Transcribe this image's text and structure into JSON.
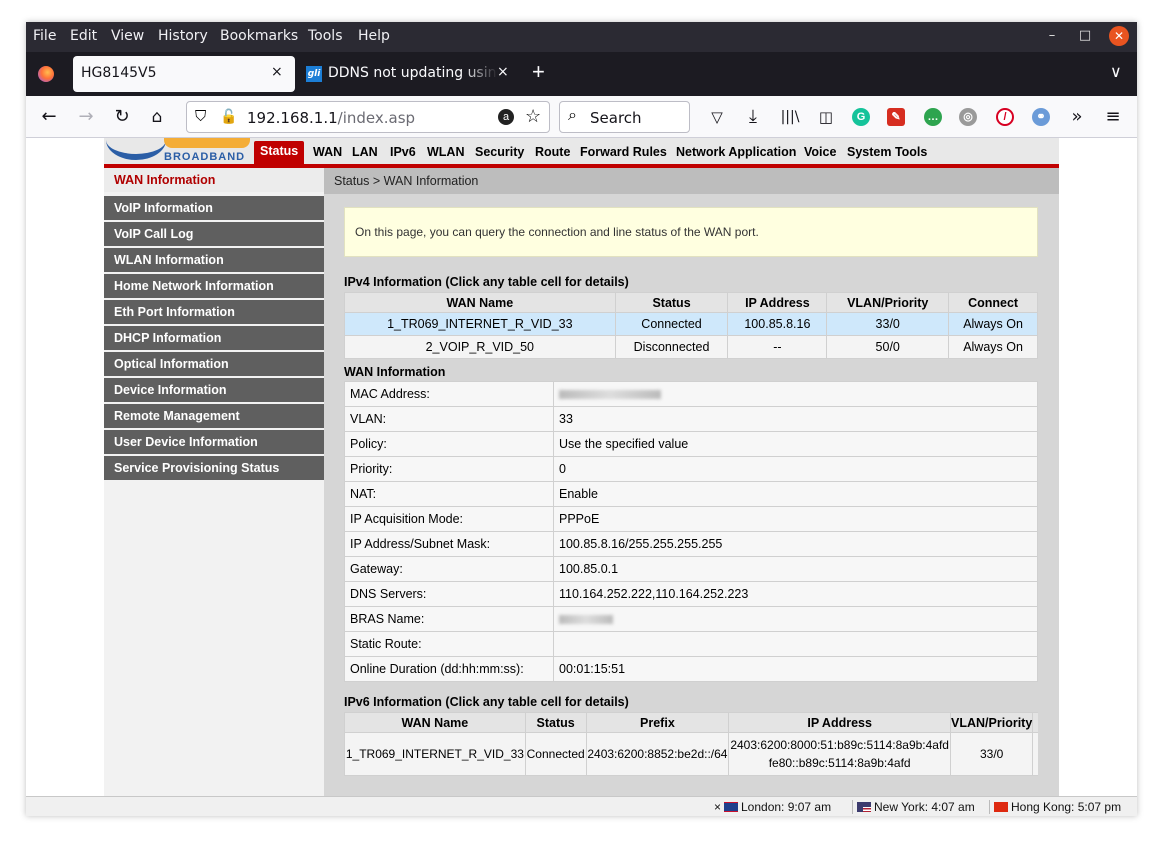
{
  "browser": {
    "menus": [
      "File",
      "Edit",
      "View",
      "History",
      "Bookmarks",
      "Tools",
      "Help"
    ],
    "tabs": [
      {
        "title": "HG8145V5",
        "close": "×"
      },
      {
        "title": "DDNS not updating using",
        "close": "×",
        "icon_text": "gli"
      }
    ],
    "new_tab": "+",
    "url_host": "192.168.1.1",
    "url_path": "/index.asp",
    "search_placeholder": "Search"
  },
  "router": {
    "logo_text": "BROADBAND",
    "top_nav": [
      "Status",
      "WAN",
      "LAN",
      "IPv6",
      "WLAN",
      "Security",
      "Route",
      "Forward Rules",
      "Network Application",
      "Voice",
      "System Tools"
    ],
    "sidebar": [
      "WAN Information",
      "VoIP Information",
      "VoIP Call Log",
      "WLAN Information",
      "Home Network Information",
      "Eth Port Information",
      "DHCP Information",
      "Optical Information",
      "Device Information",
      "Remote Management",
      "User Device Information",
      "Service Provisioning Status"
    ],
    "breadcrumb": "Status > WAN Information",
    "notice": "On this page, you can query the connection and line status of the WAN port.",
    "ipv4_title": "IPv4 Information (Click any table cell for details)",
    "ipv4_headers": [
      "WAN Name",
      "Status",
      "IP Address",
      "VLAN/Priority",
      "Connect"
    ],
    "ipv4_rows": [
      [
        "1_TR069_INTERNET_R_VID_33",
        "Connected",
        "100.85.8.16",
        "33/0",
        "Always On"
      ],
      [
        "2_VOIP_R_VID_50",
        "Disconnected",
        "--",
        "50/0",
        "Always On"
      ]
    ],
    "wan_info_title": "WAN Information",
    "wan_info": [
      {
        "label": "MAC Address:",
        "value": ""
      },
      {
        "label": "VLAN:",
        "value": "33"
      },
      {
        "label": "Policy:",
        "value": "Use the specified value"
      },
      {
        "label": "Priority:",
        "value": "0"
      },
      {
        "label": "NAT:",
        "value": "Enable"
      },
      {
        "label": "IP Acquisition Mode:",
        "value": "PPPoE"
      },
      {
        "label": "IP Address/Subnet Mask:",
        "value": "100.85.8.16/255.255.255.255"
      },
      {
        "label": "Gateway:",
        "value": "100.85.0.1"
      },
      {
        "label": "DNS Servers:",
        "value": "110.164.252.222,110.164.252.223"
      },
      {
        "label": "BRAS Name:",
        "value": ""
      },
      {
        "label": "Static Route:",
        "value": ""
      },
      {
        "label": "Online Duration (dd:hh:mm:ss):",
        "value": "00:01:15:51"
      }
    ],
    "ipv6_title": "IPv6 Information (Click any table cell for details)",
    "ipv6_headers": [
      "WAN Name",
      "Status",
      "Prefix",
      "IP Address",
      "VLAN/Priority"
    ],
    "ipv6_row": {
      "name": "1_TR069_INTERNET_R_VID_33",
      "status": "Connected",
      "prefix": "2403:6200:8852:be2d::/64",
      "ip1": "2403:6200:8000:51:b89c:5114:8a9b:4afd",
      "ip2": "fe80::b89c:5114:8a9b:4afd",
      "vlan": "33/0"
    }
  },
  "statusbar": {
    "close": "×",
    "clocks": [
      "London: 9:07 am",
      "New York: 4:07 am",
      "Hong Kong: 5:07 pm"
    ]
  }
}
